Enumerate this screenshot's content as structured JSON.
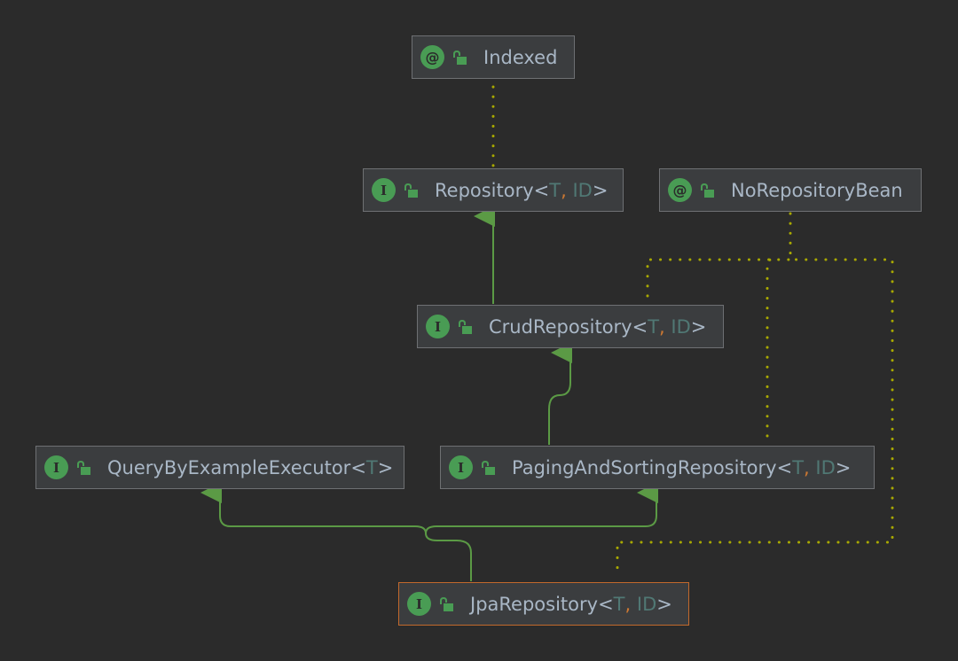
{
  "colors": {
    "background": "#2b2b2b",
    "node_fill": "#3b3d3f",
    "node_border": "#6e7073",
    "selected_border": "#c2692c",
    "text": "#a9b7c6",
    "type_param": "#507874",
    "comma": "#cc7832",
    "icon_green": "#499c54",
    "extends_line": "#5b9a45",
    "annotation_line": "#a8a800"
  },
  "nodes": {
    "indexed": {
      "kind": "annotation",
      "kind_glyph": "@",
      "icon": "unlocked-lock-icon",
      "name": "Indexed",
      "type_params": []
    },
    "repository": {
      "kind": "interface",
      "kind_glyph": "I",
      "icon": "unlocked-lock-icon",
      "name": "Repository",
      "type_params": [
        "T",
        "ID"
      ]
    },
    "norepobean": {
      "kind": "annotation",
      "kind_glyph": "@",
      "icon": "unlocked-lock-icon",
      "name": "NoRepositoryBean",
      "type_params": []
    },
    "crud": {
      "kind": "interface",
      "kind_glyph": "I",
      "icon": "unlocked-lock-icon",
      "name": "CrudRepository",
      "type_params": [
        "T",
        "ID"
      ]
    },
    "qbe": {
      "kind": "interface",
      "kind_glyph": "I",
      "icon": "unlocked-lock-icon",
      "name": "QueryByExampleExecutor",
      "type_params": [
        "T"
      ]
    },
    "paging": {
      "kind": "interface",
      "kind_glyph": "I",
      "icon": "unlocked-lock-icon",
      "name": "PagingAndSortingRepository",
      "type_params": [
        "T",
        "ID"
      ]
    },
    "jpa": {
      "kind": "interface",
      "kind_glyph": "I",
      "icon": "unlocked-lock-icon",
      "name": "JpaRepository",
      "type_params": [
        "T",
        "ID"
      ],
      "selected": true
    }
  },
  "edges": [
    {
      "from": "repository",
      "to": "indexed",
      "type": "annotated-by"
    },
    {
      "from": "crud",
      "to": "repository",
      "type": "extends"
    },
    {
      "from": "paging",
      "to": "crud",
      "type": "extends"
    },
    {
      "from": "jpa",
      "to": "qbe",
      "type": "extends"
    },
    {
      "from": "jpa",
      "to": "paging",
      "type": "extends"
    },
    {
      "from": "crud",
      "to": "norepobean",
      "type": "annotated-by"
    },
    {
      "from": "paging",
      "to": "norepobean",
      "type": "annotated-by"
    },
    {
      "from": "jpa",
      "to": "norepobean",
      "type": "annotated-by"
    }
  ]
}
